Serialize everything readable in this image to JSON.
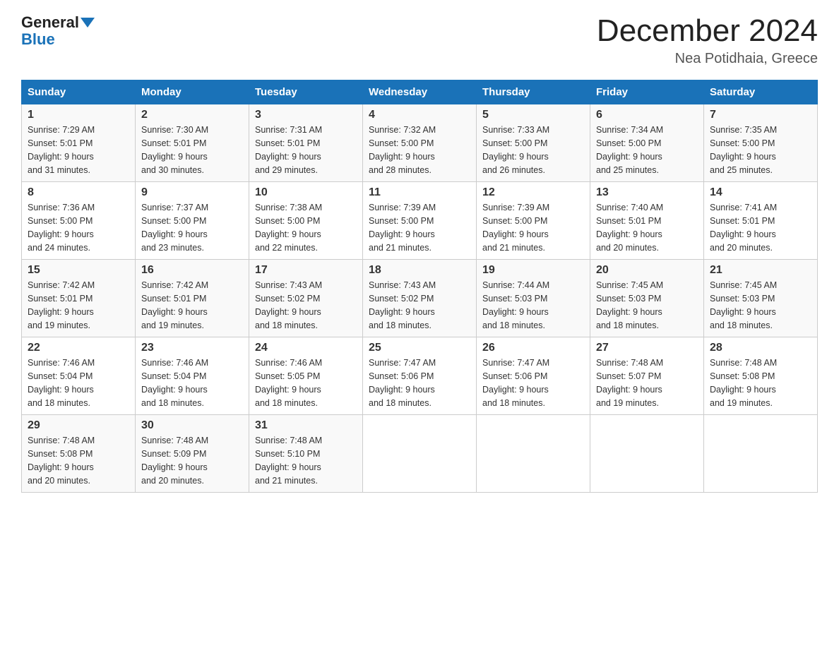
{
  "header": {
    "logo_general": "General",
    "logo_blue": "Blue",
    "month_title": "December 2024",
    "location": "Nea Potidhaia, Greece"
  },
  "days_of_week": [
    "Sunday",
    "Monday",
    "Tuesday",
    "Wednesday",
    "Thursday",
    "Friday",
    "Saturday"
  ],
  "weeks": [
    [
      {
        "day": "1",
        "sunrise": "7:29 AM",
        "sunset": "5:01 PM",
        "daylight": "9 hours and 31 minutes."
      },
      {
        "day": "2",
        "sunrise": "7:30 AM",
        "sunset": "5:01 PM",
        "daylight": "9 hours and 30 minutes."
      },
      {
        "day": "3",
        "sunrise": "7:31 AM",
        "sunset": "5:01 PM",
        "daylight": "9 hours and 29 minutes."
      },
      {
        "day": "4",
        "sunrise": "7:32 AM",
        "sunset": "5:00 PM",
        "daylight": "9 hours and 28 minutes."
      },
      {
        "day": "5",
        "sunrise": "7:33 AM",
        "sunset": "5:00 PM",
        "daylight": "9 hours and 26 minutes."
      },
      {
        "day": "6",
        "sunrise": "7:34 AM",
        "sunset": "5:00 PM",
        "daylight": "9 hours and 25 minutes."
      },
      {
        "day": "7",
        "sunrise": "7:35 AM",
        "sunset": "5:00 PM",
        "daylight": "9 hours and 25 minutes."
      }
    ],
    [
      {
        "day": "8",
        "sunrise": "7:36 AM",
        "sunset": "5:00 PM",
        "daylight": "9 hours and 24 minutes."
      },
      {
        "day": "9",
        "sunrise": "7:37 AM",
        "sunset": "5:00 PM",
        "daylight": "9 hours and 23 minutes."
      },
      {
        "day": "10",
        "sunrise": "7:38 AM",
        "sunset": "5:00 PM",
        "daylight": "9 hours and 22 minutes."
      },
      {
        "day": "11",
        "sunrise": "7:39 AM",
        "sunset": "5:00 PM",
        "daylight": "9 hours and 21 minutes."
      },
      {
        "day": "12",
        "sunrise": "7:39 AM",
        "sunset": "5:00 PM",
        "daylight": "9 hours and 21 minutes."
      },
      {
        "day": "13",
        "sunrise": "7:40 AM",
        "sunset": "5:01 PM",
        "daylight": "9 hours and 20 minutes."
      },
      {
        "day": "14",
        "sunrise": "7:41 AM",
        "sunset": "5:01 PM",
        "daylight": "9 hours and 20 minutes."
      }
    ],
    [
      {
        "day": "15",
        "sunrise": "7:42 AM",
        "sunset": "5:01 PM",
        "daylight": "9 hours and 19 minutes."
      },
      {
        "day": "16",
        "sunrise": "7:42 AM",
        "sunset": "5:01 PM",
        "daylight": "9 hours and 19 minutes."
      },
      {
        "day": "17",
        "sunrise": "7:43 AM",
        "sunset": "5:02 PM",
        "daylight": "9 hours and 18 minutes."
      },
      {
        "day": "18",
        "sunrise": "7:43 AM",
        "sunset": "5:02 PM",
        "daylight": "9 hours and 18 minutes."
      },
      {
        "day": "19",
        "sunrise": "7:44 AM",
        "sunset": "5:03 PM",
        "daylight": "9 hours and 18 minutes."
      },
      {
        "day": "20",
        "sunrise": "7:45 AM",
        "sunset": "5:03 PM",
        "daylight": "9 hours and 18 minutes."
      },
      {
        "day": "21",
        "sunrise": "7:45 AM",
        "sunset": "5:03 PM",
        "daylight": "9 hours and 18 minutes."
      }
    ],
    [
      {
        "day": "22",
        "sunrise": "7:46 AM",
        "sunset": "5:04 PM",
        "daylight": "9 hours and 18 minutes."
      },
      {
        "day": "23",
        "sunrise": "7:46 AM",
        "sunset": "5:04 PM",
        "daylight": "9 hours and 18 minutes."
      },
      {
        "day": "24",
        "sunrise": "7:46 AM",
        "sunset": "5:05 PM",
        "daylight": "9 hours and 18 minutes."
      },
      {
        "day": "25",
        "sunrise": "7:47 AM",
        "sunset": "5:06 PM",
        "daylight": "9 hours and 18 minutes."
      },
      {
        "day": "26",
        "sunrise": "7:47 AM",
        "sunset": "5:06 PM",
        "daylight": "9 hours and 18 minutes."
      },
      {
        "day": "27",
        "sunrise": "7:48 AM",
        "sunset": "5:07 PM",
        "daylight": "9 hours and 19 minutes."
      },
      {
        "day": "28",
        "sunrise": "7:48 AM",
        "sunset": "5:08 PM",
        "daylight": "9 hours and 19 minutes."
      }
    ],
    [
      {
        "day": "29",
        "sunrise": "7:48 AM",
        "sunset": "5:08 PM",
        "daylight": "9 hours and 20 minutes."
      },
      {
        "day": "30",
        "sunrise": "7:48 AM",
        "sunset": "5:09 PM",
        "daylight": "9 hours and 20 minutes."
      },
      {
        "day": "31",
        "sunrise": "7:48 AM",
        "sunset": "5:10 PM",
        "daylight": "9 hours and 21 minutes."
      },
      null,
      null,
      null,
      null
    ]
  ],
  "labels": {
    "sunrise_prefix": "Sunrise: ",
    "sunset_prefix": "Sunset: ",
    "daylight_prefix": "Daylight: "
  }
}
